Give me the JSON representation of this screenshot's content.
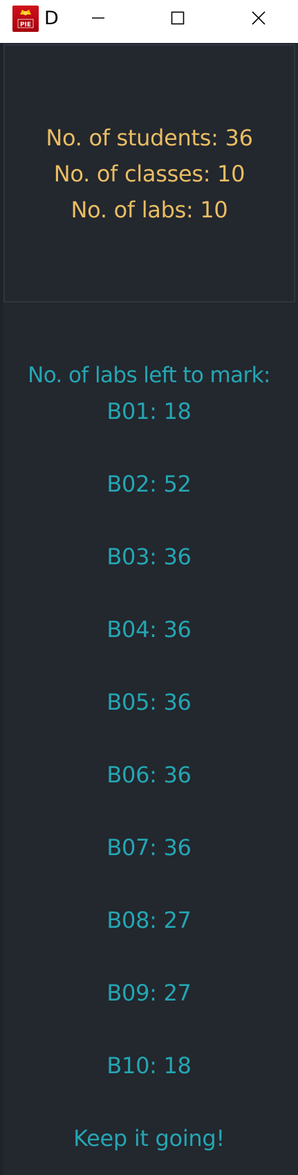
{
  "window": {
    "title": "D",
    "icon": "pie-app-icon",
    "icon_text": "PIE",
    "controls": {
      "minimize_icon": "minimize-icon",
      "maximize_icon": "maximize-icon",
      "close_icon": "close-icon"
    }
  },
  "stats": {
    "students": "No. of students: 36",
    "classes": "No. of classes: 10",
    "labs": "No. of labs: 10"
  },
  "labs_left": {
    "heading": "No. of labs left to mark:",
    "items": [
      "B01: 18",
      "B02: 52",
      "B03: 36",
      "B04: 36",
      "B05: 36",
      "B06: 36",
      "B07: 36",
      "B08: 27",
      "B09: 27",
      "B10: 18"
    ]
  },
  "footer": {
    "message": "Keep it going!"
  },
  "colors": {
    "background": "#23272e",
    "stats_text": "#eabd63",
    "labs_text": "#24a6b3",
    "titlebar": "#ffffff"
  }
}
